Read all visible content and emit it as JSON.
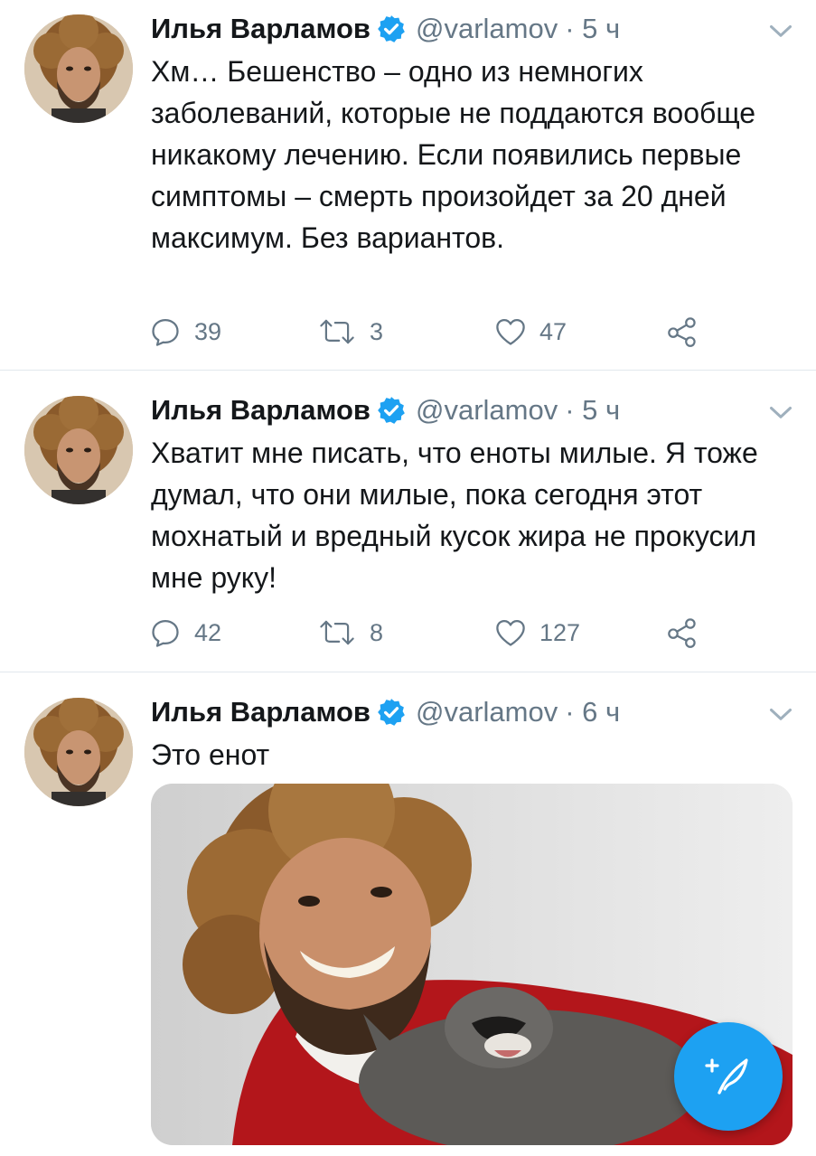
{
  "tweets": [
    {
      "author": "Илья Варламов",
      "handle": "@varlamov",
      "time": "· 5 ч",
      "text": "Хм… Бешенство – одно из немногих заболеваний, которые не поддаются вообще никакому лечению. Если появились первые симптомы – смерть произойдет за 20 дней максимум. Без вариантов.",
      "replies": "39",
      "retweets": "3",
      "likes": "47"
    },
    {
      "author": "Илья Варламов",
      "handle": "@varlamov",
      "time": "· 5 ч",
      "text": "Хватит мне писать, что еноты милые. Я тоже думал, что они милые, пока сегодня этот мохнатый и вредный кусок жира не прокусил мне руку!",
      "replies": "42",
      "retweets": "8",
      "likes": "127"
    },
    {
      "author": "Илья Варламов",
      "handle": "@varlamov",
      "time": "· 6 ч",
      "text": "Это енот"
    }
  ],
  "icons": {
    "verified": "verified-badge-icon",
    "caret": "chevron-down-icon",
    "reply": "reply-icon",
    "retweet": "retweet-icon",
    "like": "heart-icon",
    "share": "share-icon",
    "compose": "compose-tweet-icon"
  },
  "colors": {
    "accent": "#1da1f2",
    "secondary_text": "#657786",
    "divider": "#e1e8ed"
  }
}
